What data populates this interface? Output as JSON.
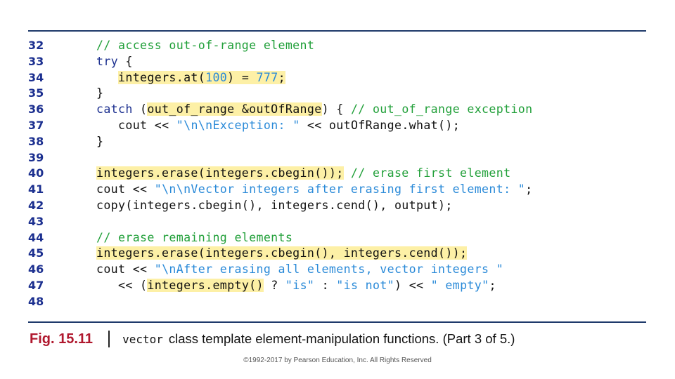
{
  "code": {
    "lines": [
      {
        "number": "32",
        "indent": "",
        "tokens": [
          {
            "text": "// access out-of-range element",
            "type": "cm",
            "hl": false
          }
        ]
      },
      {
        "number": "33",
        "indent": "",
        "tokens": [
          {
            "text": "try",
            "type": "kw",
            "hl": false
          },
          {
            "text": " {",
            "type": "pl",
            "hl": false
          }
        ]
      },
      {
        "number": "34",
        "indent": "   ",
        "tokens": [
          {
            "text": "integers.at(",
            "type": "pl",
            "hl": true
          },
          {
            "text": "100",
            "type": "st",
            "hl": true
          },
          {
            "text": ") = ",
            "type": "pl",
            "hl": true
          },
          {
            "text": "777",
            "type": "st",
            "hl": true
          },
          {
            "text": ";",
            "type": "pl",
            "hl": true
          }
        ]
      },
      {
        "number": "35",
        "indent": "",
        "tokens": [
          {
            "text": "}",
            "type": "pl",
            "hl": false
          }
        ]
      },
      {
        "number": "36",
        "indent": "",
        "tokens": [
          {
            "text": "catch",
            "type": "kw",
            "hl": false
          },
          {
            "text": " (",
            "type": "pl",
            "hl": false
          },
          {
            "text": "out_of_range &outOfRange",
            "type": "pl",
            "hl": true
          },
          {
            "text": ") { ",
            "type": "pl",
            "hl": false
          },
          {
            "text": "// out_of_range exception",
            "type": "cm",
            "hl": false
          }
        ]
      },
      {
        "number": "37",
        "indent": "   ",
        "tokens": [
          {
            "text": "cout << ",
            "type": "pl",
            "hl": false
          },
          {
            "text": "\"\\n\\nException: \"",
            "type": "st",
            "hl": false
          },
          {
            "text": " << outOfRange.what();",
            "type": "pl",
            "hl": false
          }
        ]
      },
      {
        "number": "38",
        "indent": "",
        "tokens": [
          {
            "text": "}",
            "type": "pl",
            "hl": false
          }
        ]
      },
      {
        "number": "39",
        "indent": "",
        "tokens": []
      },
      {
        "number": "40",
        "indent": "",
        "tokens": [
          {
            "text": "integers.erase(integers.cbegin());",
            "type": "pl",
            "hl": true
          },
          {
            "text": " ",
            "type": "pl",
            "hl": false
          },
          {
            "text": "// erase first element",
            "type": "cm",
            "hl": false
          }
        ]
      },
      {
        "number": "41",
        "indent": "",
        "tokens": [
          {
            "text": "cout << ",
            "type": "pl",
            "hl": false
          },
          {
            "text": "\"\\n\\nVector integers after erasing first element: \"",
            "type": "st",
            "hl": false
          },
          {
            "text": ";",
            "type": "pl",
            "hl": false
          }
        ]
      },
      {
        "number": "42",
        "indent": "",
        "tokens": [
          {
            "text": "copy(integers.cbegin(), integers.cend(), output);",
            "type": "pl",
            "hl": false
          }
        ]
      },
      {
        "number": "43",
        "indent": "",
        "tokens": []
      },
      {
        "number": "44",
        "indent": "",
        "tokens": [
          {
            "text": "// erase remaining elements",
            "type": "cm",
            "hl": false
          }
        ]
      },
      {
        "number": "45",
        "indent": "",
        "tokens": [
          {
            "text": "integers.erase(integers.cbegin(), integers.cend());",
            "type": "pl",
            "hl": true
          }
        ]
      },
      {
        "number": "46",
        "indent": "",
        "tokens": [
          {
            "text": "cout << ",
            "type": "pl",
            "hl": false
          },
          {
            "text": "\"\\nAfter erasing all elements, vector integers \"",
            "type": "st",
            "hl": false
          }
        ]
      },
      {
        "number": "47",
        "indent": "   ",
        "tokens": [
          {
            "text": "<< (",
            "type": "pl",
            "hl": false
          },
          {
            "text": "integers.empty()",
            "type": "pl",
            "hl": true
          },
          {
            "text": " ? ",
            "type": "pl",
            "hl": false
          },
          {
            "text": "\"is\"",
            "type": "st",
            "hl": false
          },
          {
            "text": " : ",
            "type": "pl",
            "hl": false
          },
          {
            "text": "\"is not\"",
            "type": "st",
            "hl": false
          },
          {
            "text": ") << ",
            "type": "pl",
            "hl": false
          },
          {
            "text": "\" empty\"",
            "type": "st",
            "hl": false
          },
          {
            "text": ";",
            "type": "pl",
            "hl": false
          }
        ]
      },
      {
        "number": "48",
        "indent": "",
        "tokens": []
      }
    ]
  },
  "caption": {
    "figure_label": "Fig. 15.11",
    "code_word": "vector",
    "text": "class template element-manipulation functions. (Part 3 of 5.)"
  },
  "footer": {
    "copyright": "©1992-2017 by Pearson Education, Inc. All Rights Reserved"
  },
  "colors": {
    "line_number": "#1b2f8f",
    "keyword": "#1b2f8f",
    "comment": "#22a03a",
    "string_literal": "#2a8ad8",
    "highlight": "#fdf0a6",
    "figure_label": "#b0182e",
    "rule": "#1f3a6b"
  }
}
